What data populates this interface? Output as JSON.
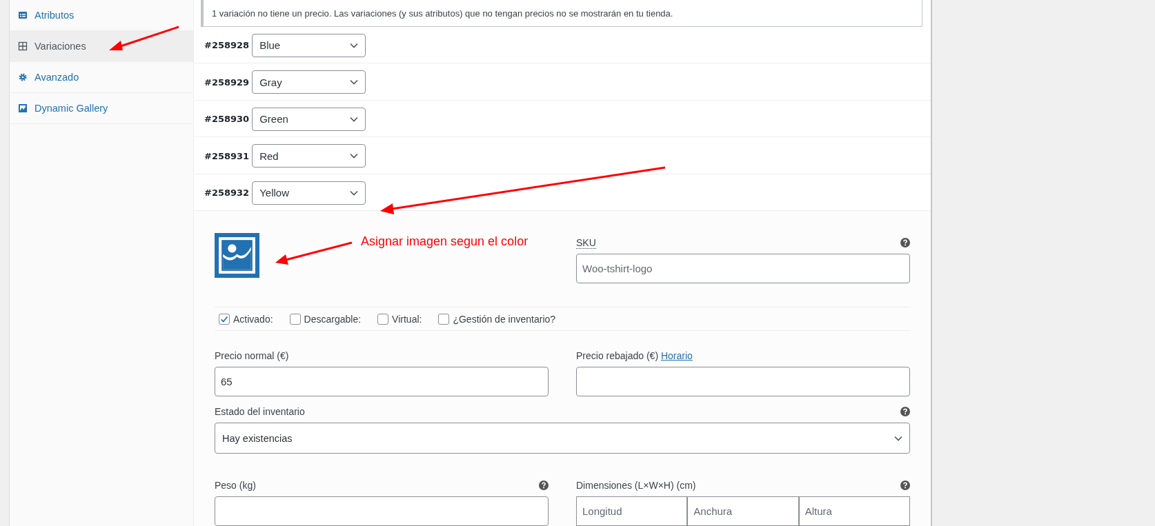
{
  "sidebar": {
    "items": [
      {
        "label": "Atributos",
        "selected": false
      },
      {
        "label": "Variaciones",
        "selected": true
      },
      {
        "label": "Avanzado",
        "selected": false
      },
      {
        "label": "Dynamic Gallery",
        "selected": false
      }
    ]
  },
  "notice": "1 variación no tiene un precio. Las variaciones (y sus atributos) que no tengan precios no se mostrarán en tu tienda.",
  "variations": [
    {
      "id": "#258928",
      "value": "Blue"
    },
    {
      "id": "#258929",
      "value": "Gray"
    },
    {
      "id": "#258930",
      "value": "Green"
    },
    {
      "id": "#258931",
      "value": "Red"
    },
    {
      "id": "#258932",
      "value": "Yellow"
    }
  ],
  "variation_detail": {
    "sku": {
      "label": "SKU",
      "value": "Woo-tshirt-logo"
    },
    "options": [
      {
        "label": "Activado:",
        "checked": true
      },
      {
        "label": "Descargable:",
        "checked": false
      },
      {
        "label": "Virtual:",
        "checked": false
      },
      {
        "label": "¿Gestión de inventario?",
        "checked": false
      }
    ],
    "regular_price": {
      "label": "Precio normal (€)",
      "value": "65"
    },
    "sale_price": {
      "label": "Precio rebajado (€)",
      "link": "Horario"
    },
    "stock_status": {
      "label": "Estado del inventario",
      "value": "Hay existencias"
    },
    "weight": {
      "label": "Peso (kg)"
    },
    "dimensions": {
      "label": "Dimensiones (L×W×H) (cm)",
      "placeholders": [
        "Longitud",
        "Anchura",
        "Altura"
      ]
    }
  },
  "annotation": {
    "text": "Asignar imagen segun el color"
  }
}
